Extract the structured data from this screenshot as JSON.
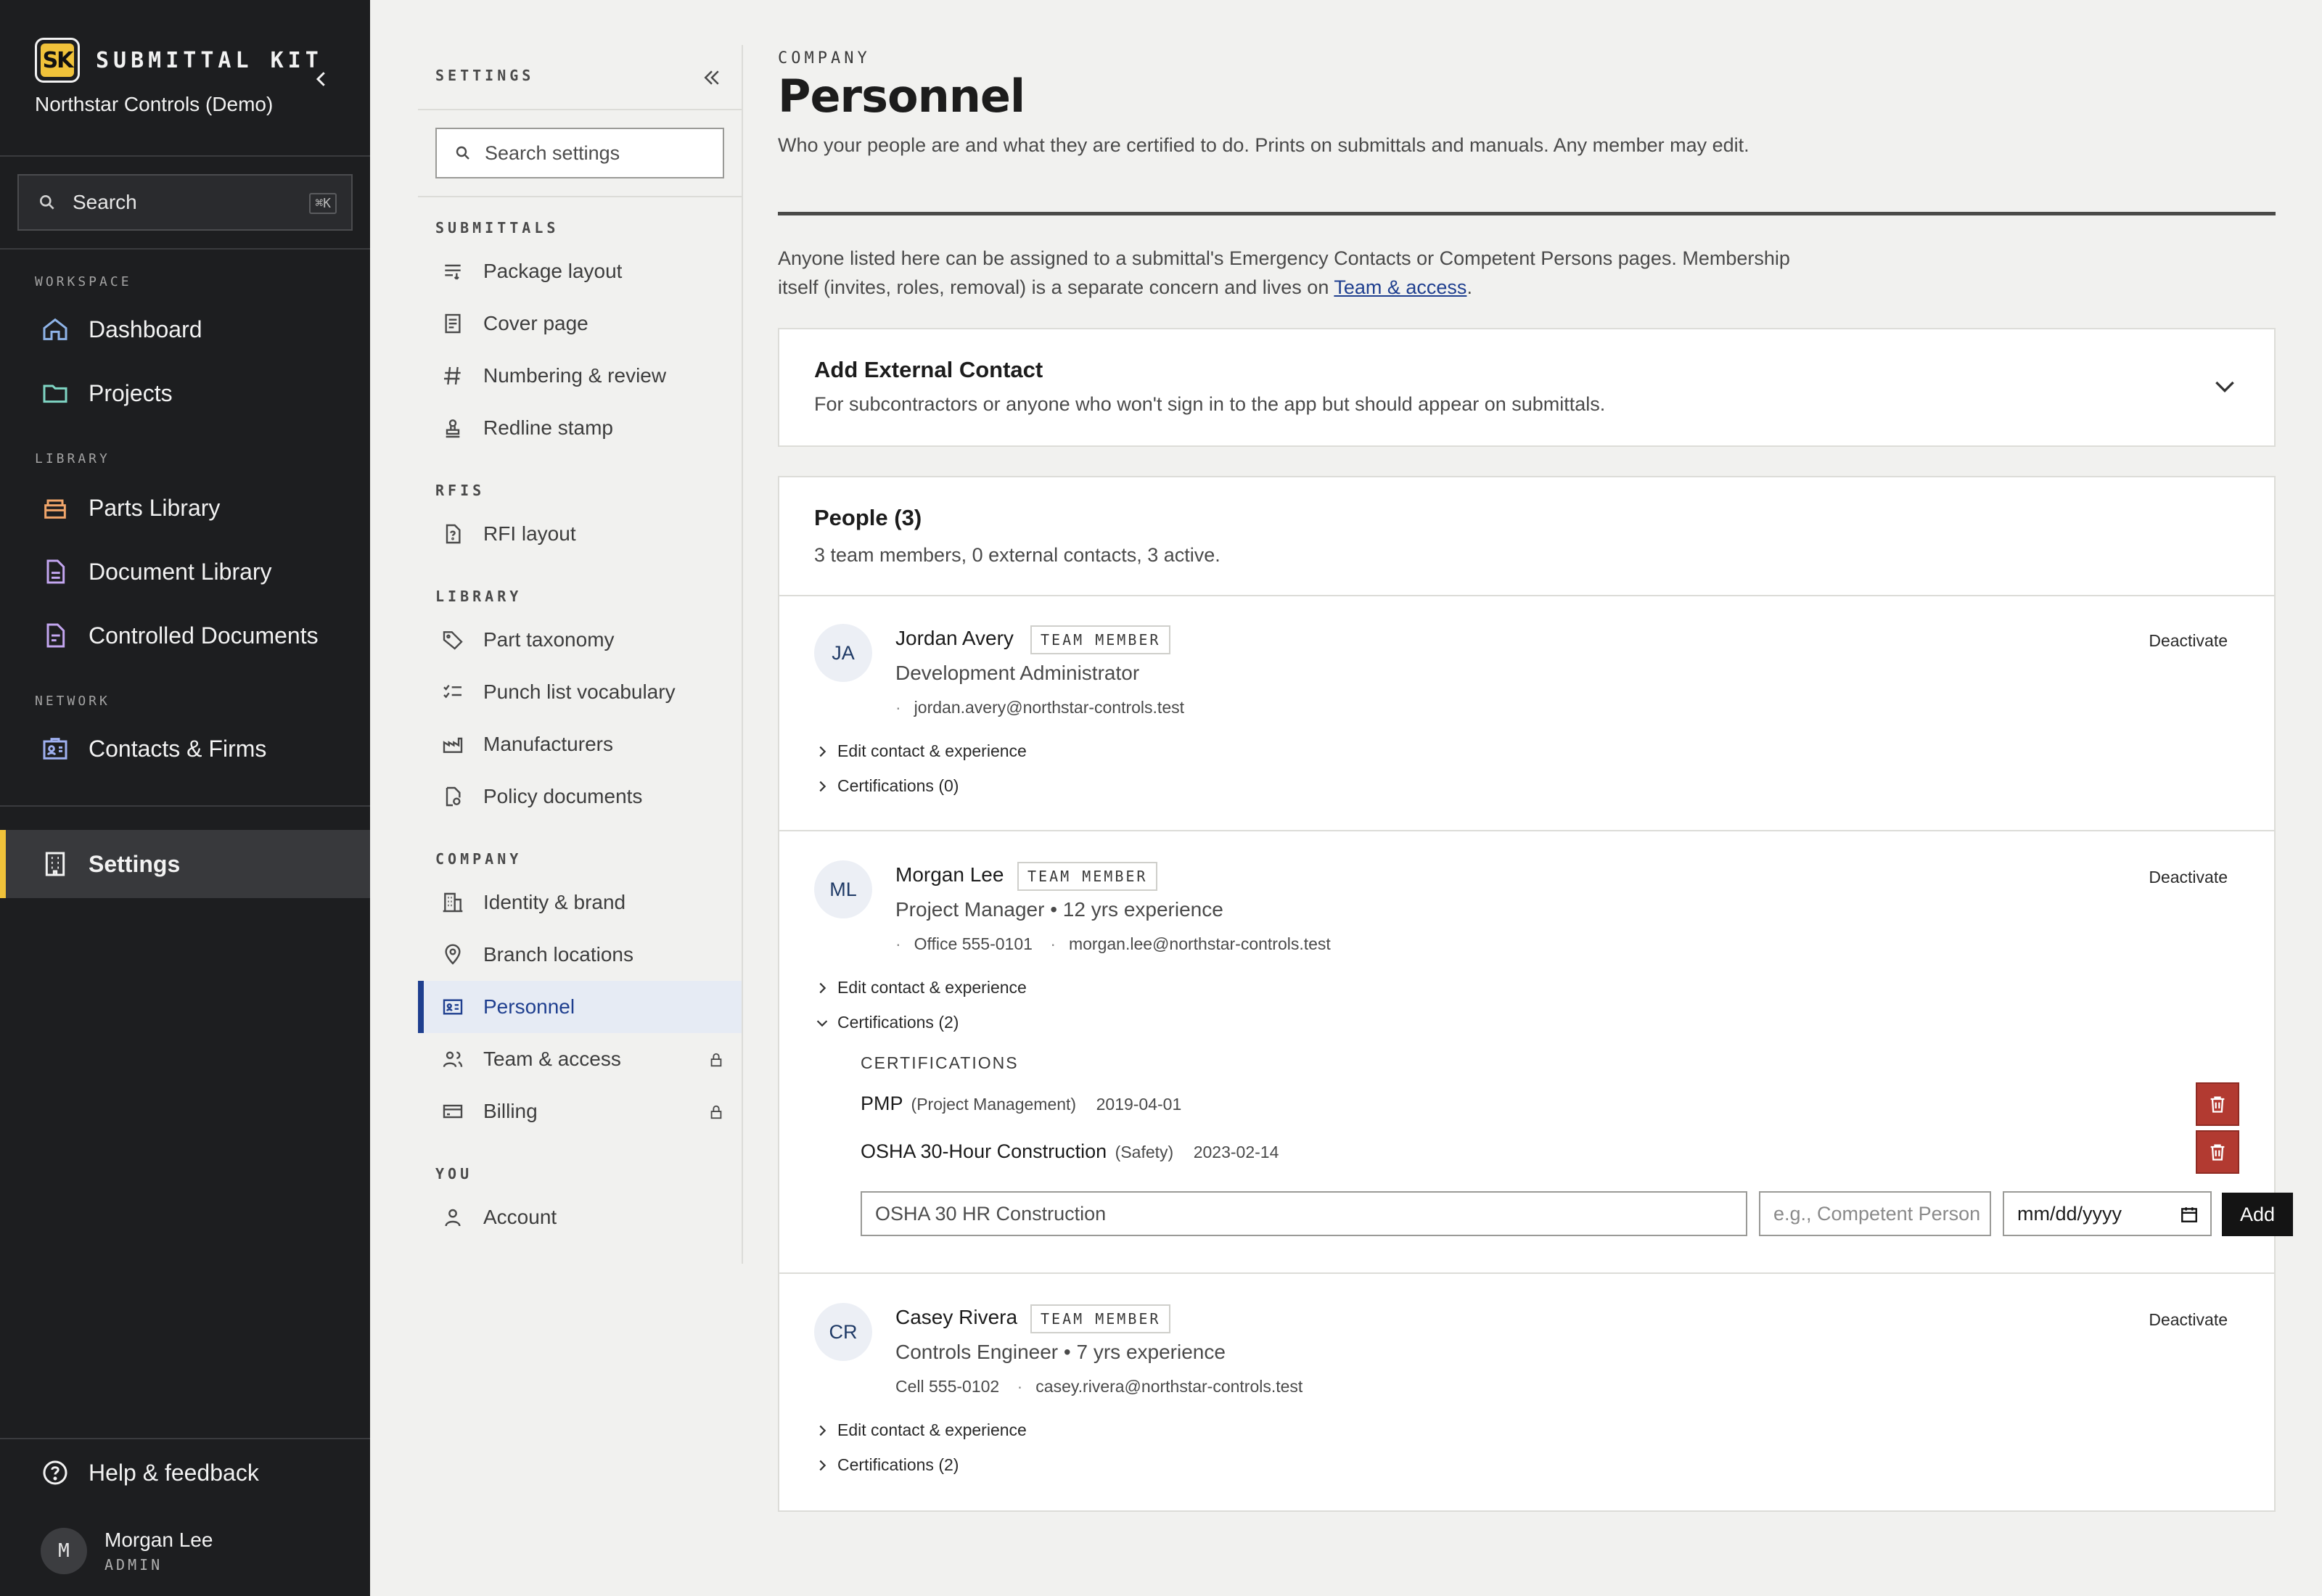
{
  "app": {
    "logo_text": "SK",
    "name": "SUBMITTAL KIT",
    "org": "Northstar Controls (Demo)"
  },
  "sidebar": {
    "search_label": "Search",
    "search_shortcut": "⌘K",
    "sections": {
      "workspace": "WORKSPACE",
      "library": "LIBRARY",
      "network": "NETWORK"
    },
    "items": [
      {
        "label": "Dashboard",
        "icon": "home-icon",
        "color": "#8fb4e8"
      },
      {
        "label": "Projects",
        "icon": "folder-icon",
        "color": "#7fd6c4"
      },
      {
        "label": "Parts Library",
        "icon": "box-icon",
        "color": "#f0a56a"
      },
      {
        "label": "Document Library",
        "icon": "document-icon",
        "color": "#c3a6f0"
      },
      {
        "label": "Controlled Documents",
        "icon": "controlled-document-icon",
        "color": "#c3a6f0"
      },
      {
        "label": "Contacts & Firms",
        "icon": "contacts-icon",
        "color": "#9fb0f0"
      },
      {
        "label": "Settings",
        "icon": "building-icon",
        "color": "#f2f2f2"
      }
    ],
    "help_label": "Help & feedback",
    "user": {
      "initial": "M",
      "name": "Morgan Lee",
      "role": "ADMIN"
    },
    "accent": "#f0c23a"
  },
  "settings_nav": {
    "title": "SETTINGS",
    "search_placeholder": "Search settings",
    "sections": {
      "submittals": "SUBMITTALS",
      "rfis": "RFIS",
      "library": "LIBRARY",
      "company": "COMPANY",
      "you": "YOU"
    },
    "items": [
      {
        "label": "Package layout",
        "icon": "list-icon"
      },
      {
        "label": "Cover page",
        "icon": "page-icon"
      },
      {
        "label": "Numbering & review",
        "icon": "hash-icon"
      },
      {
        "label": "Redline stamp",
        "icon": "stamp-icon"
      },
      {
        "label": "RFI layout",
        "icon": "question-doc-icon"
      },
      {
        "label": "Part taxonomy",
        "icon": "tag-icon"
      },
      {
        "label": "Punch list vocabulary",
        "icon": "checklist-icon"
      },
      {
        "label": "Manufacturers",
        "icon": "factory-icon"
      },
      {
        "label": "Policy documents",
        "icon": "policy-doc-icon"
      },
      {
        "label": "Identity & brand",
        "icon": "office-icon"
      },
      {
        "label": "Branch locations",
        "icon": "map-pin-icon"
      },
      {
        "label": "Personnel",
        "icon": "id-card-icon"
      },
      {
        "label": "Team & access",
        "icon": "users-icon"
      },
      {
        "label": "Billing",
        "icon": "credit-card-icon"
      },
      {
        "label": "Account",
        "icon": "user-icon"
      }
    ],
    "active": "Personnel",
    "active_color": "#1f3f8f"
  },
  "page": {
    "eyebrow": "COMPANY",
    "title": "Personnel",
    "subtitle": "Who your people are and what they are certified to do. Prints on submittals and manuals. Any member may edit.",
    "intro_1": "Anyone listed here can be assigned to a submittal's Emergency Contacts or Competent Persons pages. Membership itself (invites, roles, removal) is a separate concern and lives on",
    "intro_link": "Team & access",
    "intro_end": "."
  },
  "external_contact": {
    "title": "Add External Contact",
    "subtitle": "For subcontractors or anyone who won't sign in to the app but should appear on submittals."
  },
  "people": {
    "title": "People (3)",
    "summary": "3 team members, 0 external contacts, 3 active.",
    "badge": "TEAM MEMBER",
    "deactivate": "Deactivate",
    "edit_label": "Edit contact & experience",
    "list": [
      {
        "initials": "JA",
        "name": "Jordan Avery",
        "role": "Development Administrator",
        "phone": "",
        "email": "jordan.avery@northstar-controls.test",
        "certs_label": "Certifications (0)"
      },
      {
        "initials": "ML",
        "name": "Morgan Lee",
        "role": "Project Manager • 12 yrs experience",
        "phone": "Office 555-0101",
        "email": "morgan.lee@northstar-controls.test",
        "certs_label": "Certifications (2)",
        "certs_heading": "CERTIFICATIONS",
        "certs": [
          {
            "name": "PMP",
            "category": "(Project Management)",
            "date": "2019-04-01"
          },
          {
            "name": "OSHA 30-Hour Construction",
            "category": "(Safety)",
            "date": "2023-02-14"
          }
        ],
        "new_cert": {
          "name_value": "OSHA 30 HR Construction",
          "category_placeholder": "e.g., Competent Person",
          "date_placeholder": "mm/dd/yyyy",
          "add_label": "Add"
        }
      },
      {
        "initials": "CR",
        "name": "Casey Rivera",
        "role": "Controls Engineer • 7 yrs experience",
        "phone": "Cell 555-0102",
        "email": "casey.rivera@northstar-controls.test",
        "certs_label": "Certifications (2)"
      }
    ],
    "delete_color": "#b23a31"
  }
}
